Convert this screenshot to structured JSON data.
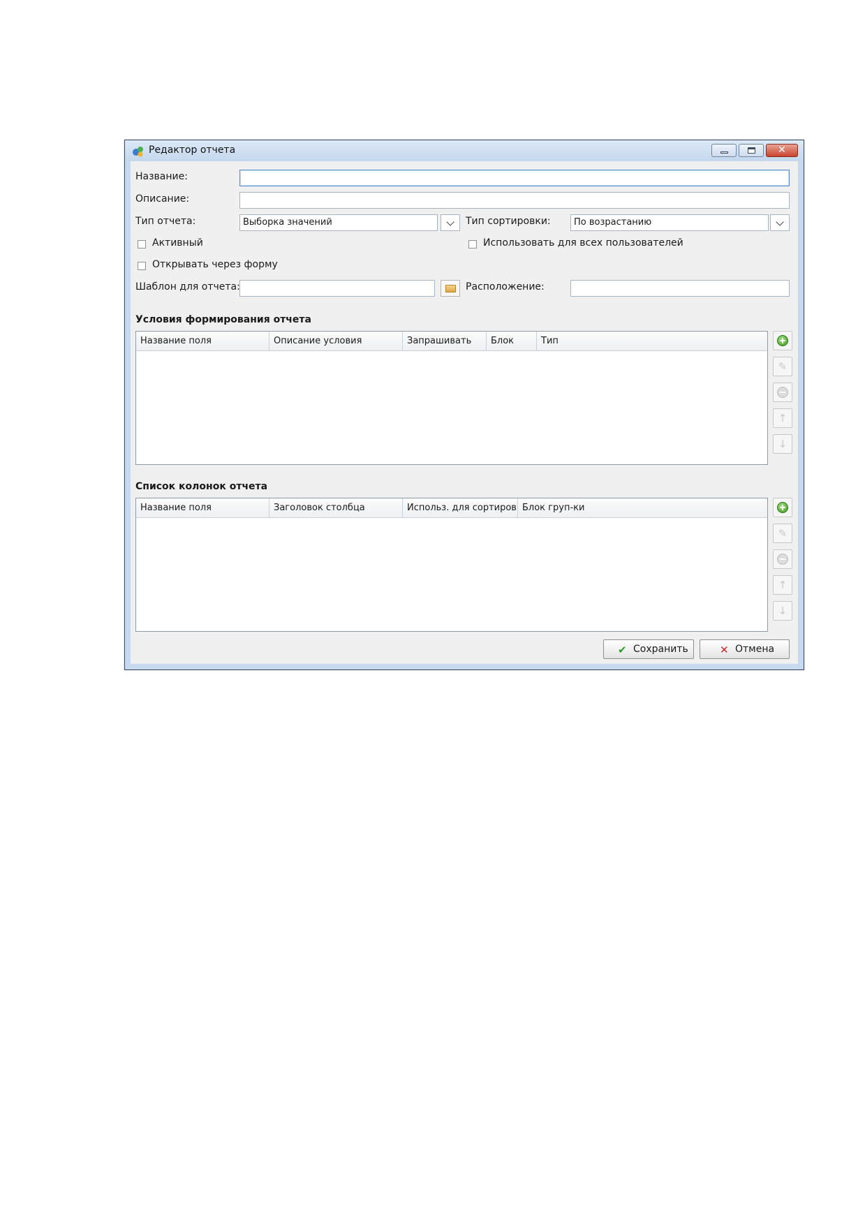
{
  "window": {
    "title": "Редактор отчета"
  },
  "form": {
    "name_label": "Название:",
    "name_value": "",
    "description_label": "Описание:",
    "description_value": "",
    "report_type_label": "Тип отчета:",
    "report_type_value": "Выборка значений",
    "sort_type_label": "Тип сортировки:",
    "sort_type_value": "По возрастанию",
    "active_label": "Активный",
    "active_checked": false,
    "all_users_label": "Использовать для всех пользователей",
    "all_users_checked": false,
    "open_via_form_label": "Открывать через форму",
    "open_via_form_checked": false,
    "template_label": "Шаблон для отчета:",
    "template_value": "",
    "location_label": "Расположение:",
    "location_value": ""
  },
  "conditions": {
    "title": "Условия формирования отчета",
    "columns": [
      "Название поля",
      "Описание условия",
      "Запрашивать",
      "Блок",
      "Тип"
    ],
    "rows": []
  },
  "report_columns": {
    "title": "Список колонок отчета",
    "columns": [
      "Название поля",
      "Заголовок столбца",
      "Использ. для сортиров",
      "Блок груп-ки"
    ],
    "rows": []
  },
  "footer": {
    "save_label": "Сохранить",
    "cancel_label": "Отмена"
  },
  "icons": {
    "add": "plus-circle-icon",
    "edit": "pencil-icon",
    "remove": "minus-circle-icon",
    "move_up": "arrow-up-icon",
    "move_down": "arrow-down-icon",
    "save": "checkmark-icon",
    "cancel": "x-icon",
    "browse": "folder-icon"
  },
  "colors": {
    "titlebar": "#c4d7ed",
    "client": "#f0f0f0",
    "add_green": "#3f9a1f",
    "cancel_red": "#c62828",
    "save_green": "#2e9a2e"
  }
}
